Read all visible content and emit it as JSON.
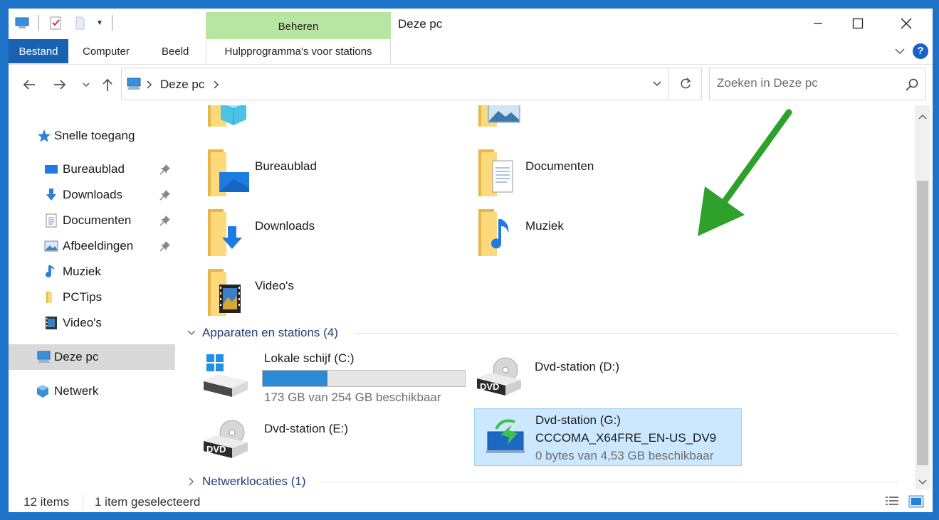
{
  "window": {
    "title": "Deze pc"
  },
  "ribbon": {
    "context_group": "Beheren",
    "tabs": [
      {
        "label": "Bestand"
      },
      {
        "label": "Computer"
      },
      {
        "label": "Beeld"
      },
      {
        "label": "Hulpprogramma's voor stations"
      }
    ],
    "help": "?"
  },
  "address": {
    "crumb": "Deze pc"
  },
  "search": {
    "placeholder": "Zoeken in Deze pc"
  },
  "sidebar": {
    "quick_access": "Snelle toegang",
    "items": [
      {
        "label": "Bureaublad",
        "icon": "desktop-icon",
        "pinned": true
      },
      {
        "label": "Downloads",
        "icon": "download-icon",
        "pinned": true
      },
      {
        "label": "Documenten",
        "icon": "document-icon",
        "pinned": true
      },
      {
        "label": "Afbeeldingen",
        "icon": "picture-icon",
        "pinned": true
      },
      {
        "label": "Muziek",
        "icon": "music-icon",
        "pinned": false
      },
      {
        "label": "PCTips",
        "icon": "folder-icon",
        "pinned": false
      },
      {
        "label": "Video's",
        "icon": "video-icon",
        "pinned": false
      }
    ],
    "this_pc": "Deze pc",
    "network": "Netwerk"
  },
  "folders": [
    {
      "label": "Bureaublad",
      "icon": "desktop-folder-icon"
    },
    {
      "label": "Documenten",
      "icon": "documents-folder-icon"
    },
    {
      "label": "Downloads",
      "icon": "downloads-folder-icon"
    },
    {
      "label": "Muziek",
      "icon": "music-folder-icon"
    },
    {
      "label": "Video's",
      "icon": "videos-folder-icon"
    }
  ],
  "groups": {
    "devices": "Apparaten en stations (4)",
    "network": "Netwerklocaties (1)"
  },
  "drives": {
    "c": {
      "name": "Lokale schijf (C:)",
      "free": "173 GB van 254 GB beschikbaar",
      "used_fraction": 0.32
    },
    "d": {
      "name": "Dvd-station (D:)",
      "badge": "DVD"
    },
    "e": {
      "name": "Dvd-station (E:)",
      "badge": "DVD"
    },
    "g": {
      "name": "Dvd-station (G:)",
      "volume": "CCCOMA_X64FRE_EN-US_DV9",
      "free": "0 bytes van 4,53 GB beschikbaar"
    }
  },
  "status": {
    "count": "12 items",
    "selected": "1 item geselecteerd"
  },
  "colors": {
    "accent": "#1961b3",
    "selection": "#cce8ff",
    "annotation": "#2da12b",
    "context_tab": "#b8e6a1",
    "capacity_fill": "#2a8ad4"
  }
}
